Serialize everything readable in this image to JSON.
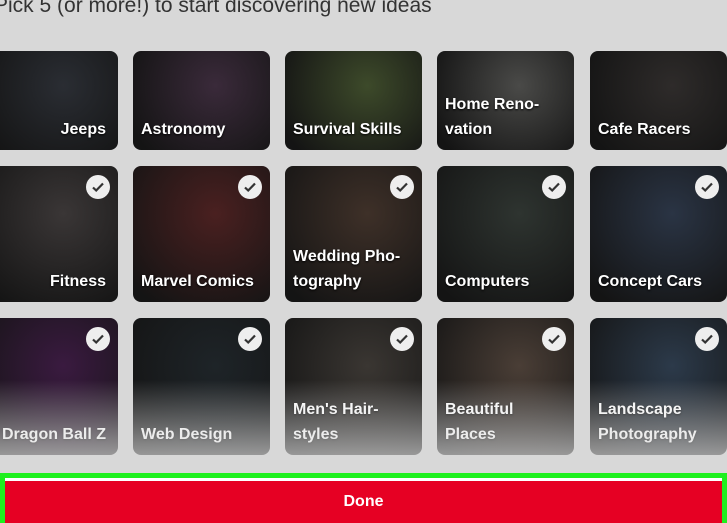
{
  "header": {
    "title": "Pick 5 (or more!) to start discovering new ideas"
  },
  "tiles": [
    {
      "label": "Jeeps",
      "selected": false,
      "color": "#2a2d33"
    },
    {
      "label": "Astronomy",
      "selected": false,
      "color": "#3a2a3a"
    },
    {
      "label": "Survival Skills",
      "selected": false,
      "color": "#3d4a2a"
    },
    {
      "label": "Home Reno-vation",
      "selected": false,
      "color": "#4a4a48"
    },
    {
      "label": "Cafe Racers",
      "selected": false,
      "color": "#2e2b2a"
    },
    {
      "label": "Fitness",
      "selected": true,
      "color": "#3a3636"
    },
    {
      "label": "Marvel Comics",
      "selected": true,
      "color": "#4a2020"
    },
    {
      "label": "Wedding Pho-tography",
      "selected": true,
      "color": "#3e3028"
    },
    {
      "label": "Computers",
      "selected": true,
      "color": "#2e3430"
    },
    {
      "label": "Concept Cars",
      "selected": true,
      "color": "#2a3444"
    },
    {
      "label": "Dragon Ball Z",
      "selected": true,
      "color": "#3a1a40"
    },
    {
      "label": "Web Design",
      "selected": true,
      "color": "#1e2428"
    },
    {
      "label": "Men's Hair-styles",
      "selected": true,
      "color": "#3a3632"
    },
    {
      "label": "Beautiful Places",
      "selected": true,
      "color": "#4a3e36"
    },
    {
      "label": "Landscape Photography",
      "selected": true,
      "color": "#2c3a4a"
    }
  ],
  "done_button": {
    "label": "Done"
  },
  "colors": {
    "accent": "#e60023",
    "highlight": "#1ef01e"
  }
}
